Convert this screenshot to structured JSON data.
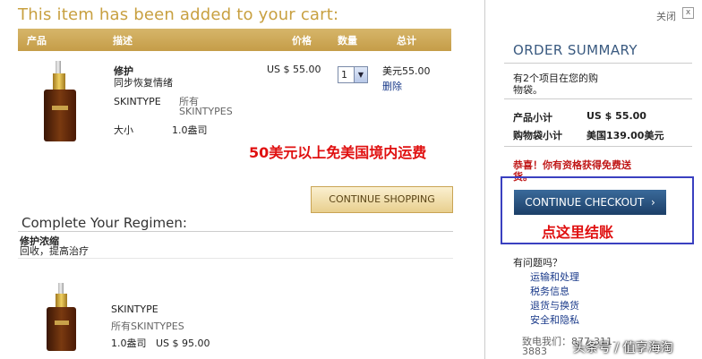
{
  "cart": {
    "title": "This item has been added to your cart:",
    "columns": {
      "product": "产品",
      "description": "描述",
      "price": "价格",
      "quantity": "数量",
      "total": "总计"
    },
    "item": {
      "name": "修护",
      "subtitle": "同步恢复情绪",
      "skintype_label": "SKINTYPE",
      "skintype_value_line1": "所有",
      "skintype_value_line2": "SKINTYPES",
      "size_label": "大小",
      "size_value": "1.0盎司",
      "price": "US $ 55.00",
      "quantity": "1",
      "total": "美元55.00",
      "remove": "删除"
    },
    "promo_overlay": "50美元以上免美国境内运费",
    "continue_shopping": "CONTINUE SHOPPING"
  },
  "regimen": {
    "title": "Complete Your Regimen:",
    "item_name": "修护浓缩",
    "item_desc": "回收，提高治疗",
    "skintype_label": "SKINTYPE",
    "skintype_value": "所有SKINTYPES",
    "size_price": "1.0盎司   US $ 95.00"
  },
  "summary": {
    "close_label": "关闭",
    "close_icon": "x",
    "title": "ORDER SUMMARY",
    "items_text_line1": "有2个项目在您的购",
    "items_text_line2": "物袋。",
    "subtotal_label": "产品小计",
    "subtotal_value": "US $ 55.00",
    "bag_subtotal_label": "购物袋小计",
    "bag_subtotal_value": "美国139.00美元",
    "free_shipping_line1": "恭喜！你有资格获得免费送",
    "free_shipping_line2": "货。",
    "checkout_button": "CONTINUE CHECKOUT",
    "checkout_arrow": "›",
    "click_here_overlay": "点这里结账",
    "help_title": "有问题吗？",
    "help_links": [
      "运输和处理",
      "税务信息",
      "退货与换货",
      "安全和隐私"
    ],
    "phone_line1": "致电我们：877-311-",
    "phone_line2": "3883"
  },
  "watermark": "头条号 / 值享海淘",
  "colors": {
    "gold": "#c8a040",
    "navy_button": "#1c3f68",
    "red": "#e01010",
    "summary_title": "#3a5a80"
  }
}
